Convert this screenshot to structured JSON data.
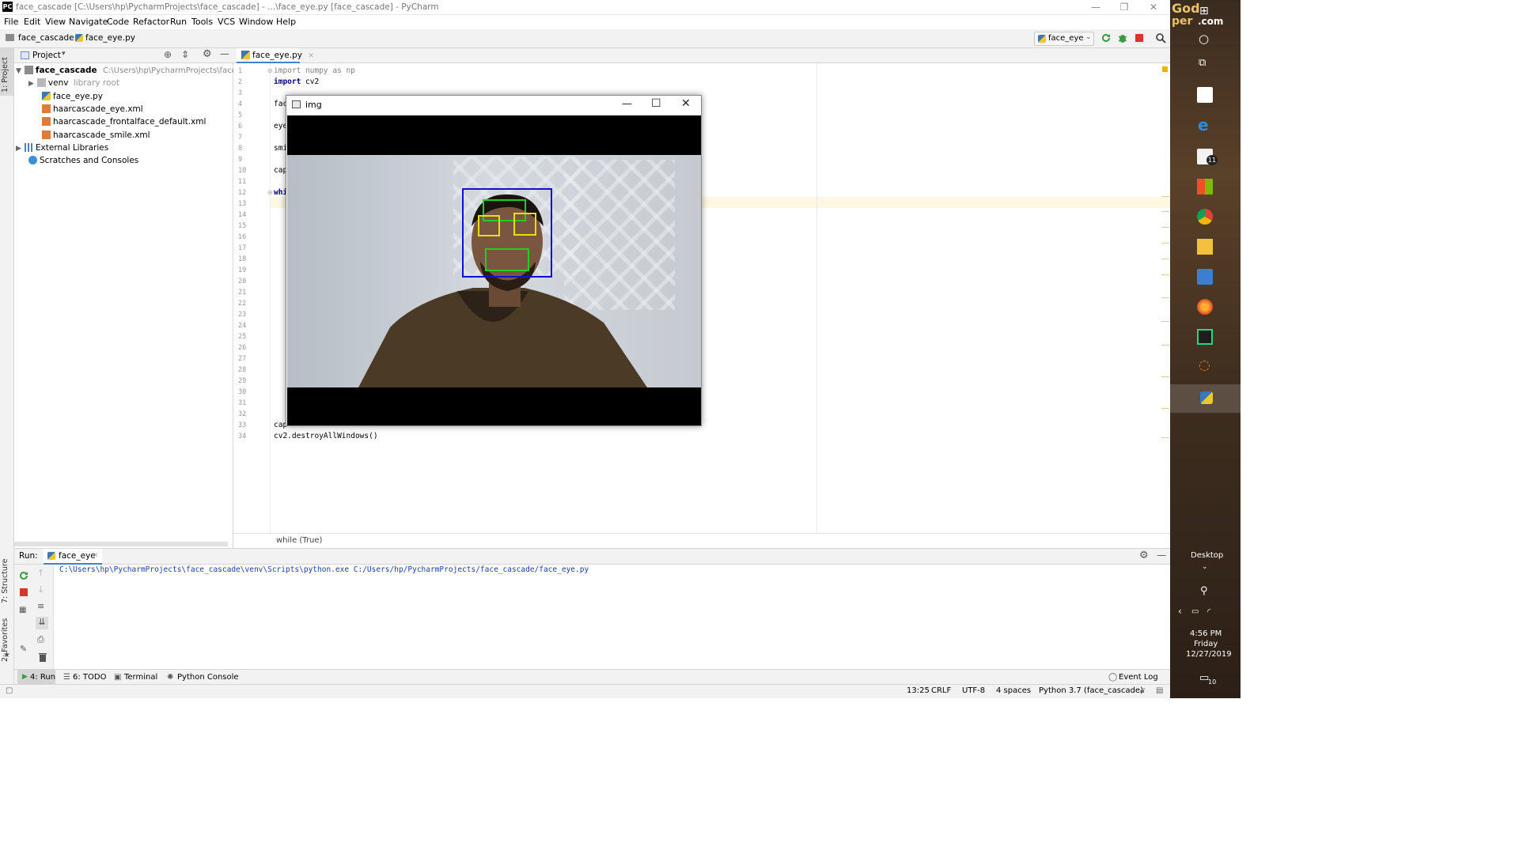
{
  "window": {
    "app_badge": "PC",
    "title": "face_cascade [C:\\Users\\hp\\PycharmProjects\\face_cascade] - ...\\face_eye.py [face_cascade] - PyCharm"
  },
  "menu": [
    "File",
    "Edit",
    "View",
    "Navigate",
    "Code",
    "Refactor",
    "Run",
    "Tools",
    "VCS",
    "Window",
    "Help"
  ],
  "nav": {
    "project": "face_cascade",
    "file": "face_eye.py",
    "run_config": "face_eye"
  },
  "side": {
    "project_tab": "1: Project",
    "structure_tab": "7: Structure",
    "favorites_tab": "2: Favorites"
  },
  "project_panel": {
    "title": "Project",
    "root": "face_cascade",
    "root_path": "C:\\Users\\hp\\PycharmProjects\\face_cascade",
    "venv": "venv",
    "venv_note": "library root",
    "files": [
      "face_eye.py",
      "haarcascade_eye.xml",
      "haarcascade_frontalface_default.xml",
      "haarcascade_smile.xml"
    ],
    "external": "External Libraries",
    "scratches": "Scratches and Consoles"
  },
  "editor": {
    "tab": "face_eye.py",
    "line_numbers": [
      "1",
      "2",
      "3",
      "4",
      "5",
      "6",
      "7",
      "8",
      "9",
      "10",
      "11",
      "12",
      "13",
      "14",
      "15",
      "16",
      "17",
      "18",
      "19",
      "20",
      "21",
      "22",
      "23",
      "24",
      "25",
      "26",
      "27",
      "28",
      "29",
      "30",
      "31",
      "32",
      "33",
      "34"
    ],
    "line1": "import numpy as np",
    "line2_kw": "import",
    "line2_rest": " cv2",
    "line4": "fac",
    "line6": "eye",
    "line8": "smi",
    "line10": "cap",
    "line12": "whi",
    "line33": "cap",
    "line34": "cv2.destroyAllWindows()",
    "breadcrumb": "while (True)"
  },
  "img_window": {
    "title": "img"
  },
  "run_panel": {
    "label": "Run:",
    "tab": "face_eye",
    "command": "C:\\Users\\hp\\PycharmProjects\\face_cascade\\venv\\Scripts\\python.exe C:/Users/hp/PycharmProjects/face_cascade/face_eye.py"
  },
  "bottom_tabs": {
    "run": "4: Run",
    "todo": "6: TODO",
    "terminal": "Terminal",
    "console": "Python Console",
    "event_log": "Event Log"
  },
  "status": {
    "position": "13:25",
    "line_sep": "CRLF",
    "encoding": "UTF-8",
    "indent": "4 spaces",
    "interpreter": "Python 3.7 (face_cascade)"
  },
  "taskbar": {
    "brand_line1": "God",
    "brand_line2": "per",
    "brand_line3": ".com",
    "mail_badge": "11",
    "desktop": "Desktop",
    "time": "4:56 PM",
    "day": "Friday",
    "date": "12/27/2019",
    "notif_badge": "10"
  },
  "colors": {
    "face_box": "#1010d0",
    "eye_box": "#e8e000",
    "smile_box": "#20d020",
    "accent": "#4083c9"
  }
}
